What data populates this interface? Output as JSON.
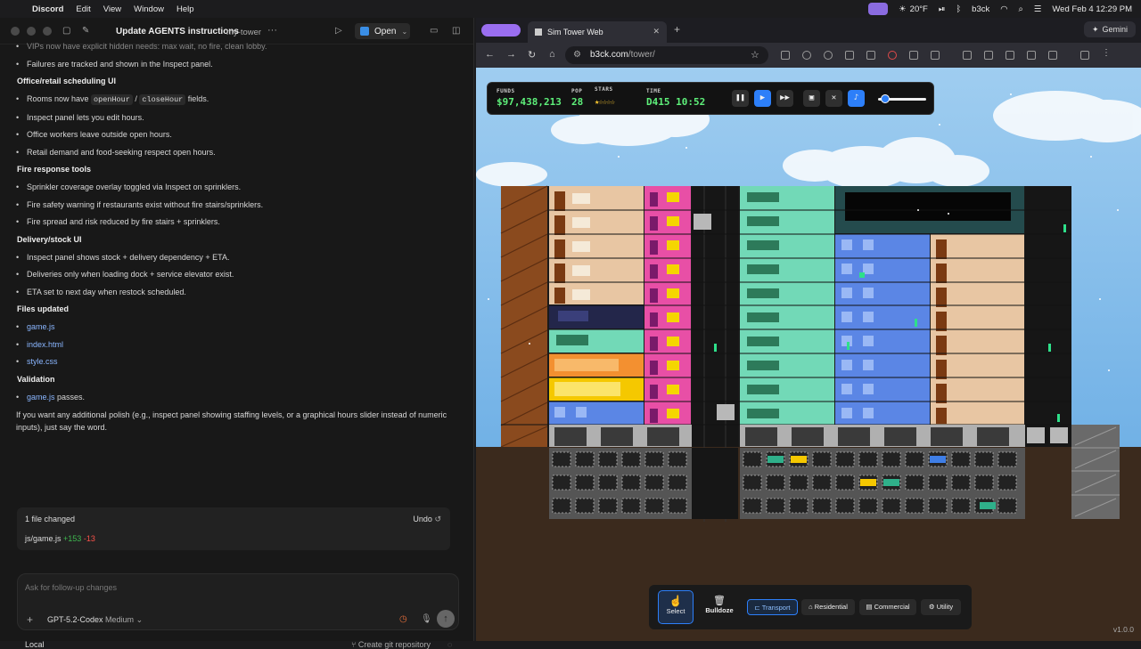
{
  "menubar": {
    "app": "Discord",
    "items": [
      "Edit",
      "View",
      "Window",
      "Help"
    ],
    "temp": "20°F",
    "user": "b3ck",
    "datetime": "Wed Feb 4  12:29 PM"
  },
  "left": {
    "title": "Update AGENTS instructions",
    "project": "my-tower",
    "open_label": "Open",
    "content": {
      "top_cut": "VIPs now have explicit hidden needs: max wait, no fire, clean lobby.",
      "top_item": "Failures are tracked and shown in the Inspect panel.",
      "sections": [
        {
          "heading": "Office/retail scheduling UI",
          "items": [
            "Rooms now have openHour / closeHour fields.",
            "Inspect panel lets you edit hours.",
            "Office workers leave outside open hours.",
            "Retail demand and food-seeking respect open hours."
          ]
        },
        {
          "heading": "Fire response tools",
          "items": [
            "Sprinkler coverage overlay toggled via Inspect on sprinklers.",
            "Fire safety warning if restaurants exist without fire stairs/sprinklers.",
            "Fire spread and risk reduced by fire stairs + sprinklers."
          ]
        },
        {
          "heading": "Delivery/stock UI",
          "items": [
            "Inspect panel shows stock + delivery dependency + ETA.",
            "Deliveries only when loading dock + service elevator exist.",
            "ETA set to next day when restock scheduled."
          ]
        }
      ],
      "files_heading": "Files updated",
      "files": [
        "game.js",
        "index.html",
        "style.css"
      ],
      "validation_heading": "Validation",
      "validation_file": "game.js",
      "validation_rest": " passes.",
      "closing": "If you want any additional polish (e.g., inspect panel showing staffing levels, or a graphical hours slider instead of numeric inputs), just say the word."
    },
    "changes": {
      "summary": "1 file changed",
      "undo": "Undo",
      "file": "js/game.js",
      "added": "+153",
      "removed": "-13"
    },
    "input": {
      "placeholder": "Ask for follow-up changes",
      "model": "GPT-5.2-Codex",
      "effort": "Medium"
    },
    "footer": {
      "env": "Local",
      "git": "Create git repository"
    }
  },
  "browser": {
    "tab_title": "Sim Tower Web",
    "gemini": "Gemini",
    "url_host": "b3ck.com",
    "url_path": "/tower/",
    "accent": "#2d7ff9"
  },
  "game": {
    "hud": {
      "funds_label": "FUNDS",
      "funds": "$97,438,213",
      "pop_label": "POP",
      "pop": "28",
      "stars_label": "STARS",
      "stars": "★☆☆☆☆",
      "time_label": "TIME",
      "time": "D415 10:52",
      "volume_level": 0.1
    },
    "toolbar": {
      "select": "Select",
      "bulldoze": "Bulldoze",
      "transport": "Transport",
      "residential": "Residential",
      "commercial": "Commercial",
      "utility": "Utility"
    },
    "version": "v1.0.0"
  }
}
